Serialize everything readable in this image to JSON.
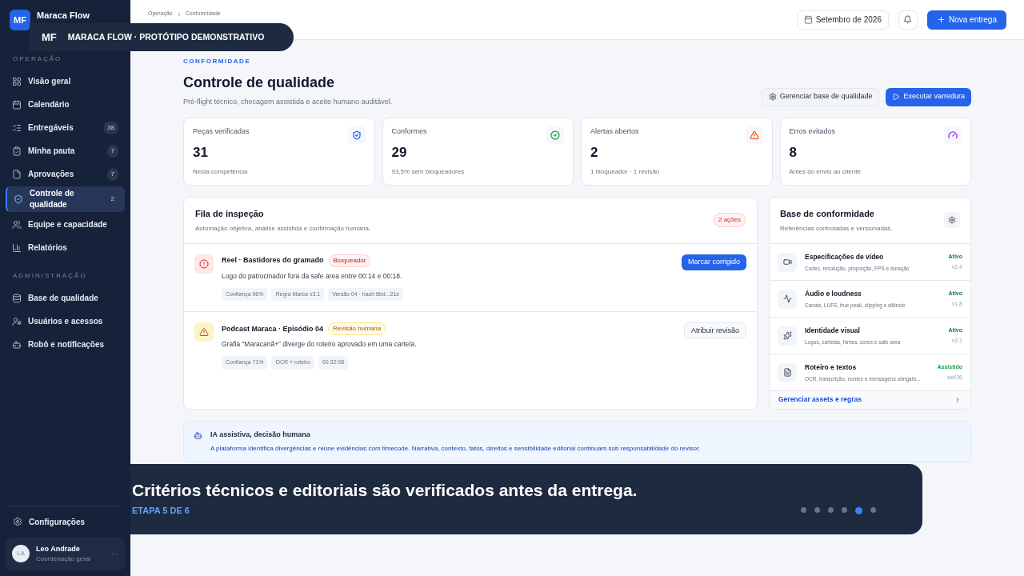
{
  "brand": {
    "logo": "MF",
    "name": "Maraca Flow"
  },
  "overlay_banner": {
    "logo": "MF",
    "text": "MARACA FLOW · PROTÓTIPO DEMONSTRATIVO"
  },
  "sidebar": {
    "sections": [
      {
        "title": "OPERAÇÃO",
        "items": [
          {
            "label": "Visão geral",
            "selected": false
          },
          {
            "label": "Calendário",
            "selected": false
          },
          {
            "label": "Entregáveis",
            "badge": "38",
            "selected": false
          },
          {
            "label": "Minha pauta",
            "badge": "7",
            "selected": false
          },
          {
            "label": "Aprovações",
            "badge": "7",
            "selected": false
          },
          {
            "label": "Controle de qualidade",
            "badge": "2",
            "selected": true
          },
          {
            "label": "Equipe e capacidade",
            "selected": false
          },
          {
            "label": "Relatórios",
            "selected": false
          }
        ]
      },
      {
        "title": "ADMINISTRAÇÃO",
        "items": [
          {
            "label": "Base de qualidade",
            "selected": false
          },
          {
            "label": "Usuários e acessos",
            "selected": false
          },
          {
            "label": "Robô e notificações",
            "selected": false
          }
        ]
      }
    ],
    "settings": "Configurações",
    "user": {
      "initials": "LA",
      "name": "Leo Andrade",
      "role": "Coordenação geral",
      "more": "···"
    }
  },
  "header": {
    "breadcrumb": [
      "Operação",
      "Conformidade"
    ],
    "period": "Setembro de 2026",
    "new_button": "Nova entrega"
  },
  "page": {
    "eyebrow": "CONFORMIDADE",
    "title": "Controle de qualidade",
    "subtitle": "Pré-flight técnico, checagem assistida e aceite humano auditável.",
    "secondary_button": "Gerenciar base de qualidade",
    "primary_button": "Executar varredura"
  },
  "stats": [
    {
      "label": "Peças verificadas",
      "value": "31",
      "note": "Nesta competência"
    },
    {
      "label": "Conformes",
      "value": "29",
      "note": "93,5% sem bloqueadores"
    },
    {
      "label": "Alertas abertos",
      "value": "2",
      "note": "1 bloqueador · 1 revisão"
    },
    {
      "label": "Erros evitados",
      "value": "8",
      "note": "Antes do envio ao cliente"
    }
  ],
  "queue": {
    "title": "Fila de inspeção",
    "subtitle": "Automação objetiva, análise assistida e confirmação humana.",
    "count": "2 ações",
    "items": [
      {
        "kind": "blocker",
        "title": "Reel · Bastidores do gramado",
        "tag": "Bloqueador",
        "description": "Logo do patrocinador fora da safe area entre 00:14 e 00:18.",
        "chips": [
          "Confiança 96%",
          "Regra Marca v3.1",
          "Versão 04 · hash 8bd...21e"
        ],
        "action": "Marcar corrigido"
      },
      {
        "kind": "review",
        "title": "Podcast Maraca · Episódio 04",
        "tag": "Revisão humana",
        "description": "Grafia “Maracanã+” diverge do roteiro aprovado em uma cartela.",
        "chips": [
          "Confiança 71%",
          "OCR + roteiro",
          "00:32:08"
        ],
        "action": "Atribuir revisão"
      }
    ]
  },
  "base": {
    "title": "Base de conformidade",
    "subtitle": "Referências controladas e versionadas.",
    "items": [
      {
        "title": "Especificações de vídeo",
        "description": "Codec, resolução, proporção, FPS e duração",
        "status": "Ativo",
        "version": "v2.4",
        "color": "#15803d"
      },
      {
        "title": "Áudio e loudness",
        "description": "Canais, LUFS, true peak, clipping e silêncio",
        "status": "Ativo",
        "version": "v1.8",
        "color": "#15803d"
      },
      {
        "title": "Identidade visual",
        "description": "Logos, cartelas, fontes, cores e safe area",
        "status": "Ativo",
        "version": "v3.1",
        "color": "#15803d"
      },
      {
        "title": "Roteiro e textos",
        "description": "OCR, transcrição, nomes e mensagens obrigató...",
        "status": "Assistido",
        "version": "set/26",
        "color": "#16a34a"
      }
    ],
    "link": "Gerenciar assets e regras"
  },
  "notice": {
    "title": "IA assistiva, decisão humana",
    "text": "A plataforma identifica divergências e reúne evidências com timecode. Narrativa, contexto, fatos, direitos e sensibilidade editorial continuam sob responsabilidade do revisor."
  },
  "caption": {
    "text": "Critérios técnicos e editoriais são verificados antes da entrega.",
    "step": "ETAPA 5 DE 6",
    "dots": [
      {
        "selected": false
      },
      {
        "selected": false
      },
      {
        "selected": false
      },
      {
        "selected": false
      },
      {
        "selected": true
      },
      {
        "selected": false
      }
    ]
  }
}
